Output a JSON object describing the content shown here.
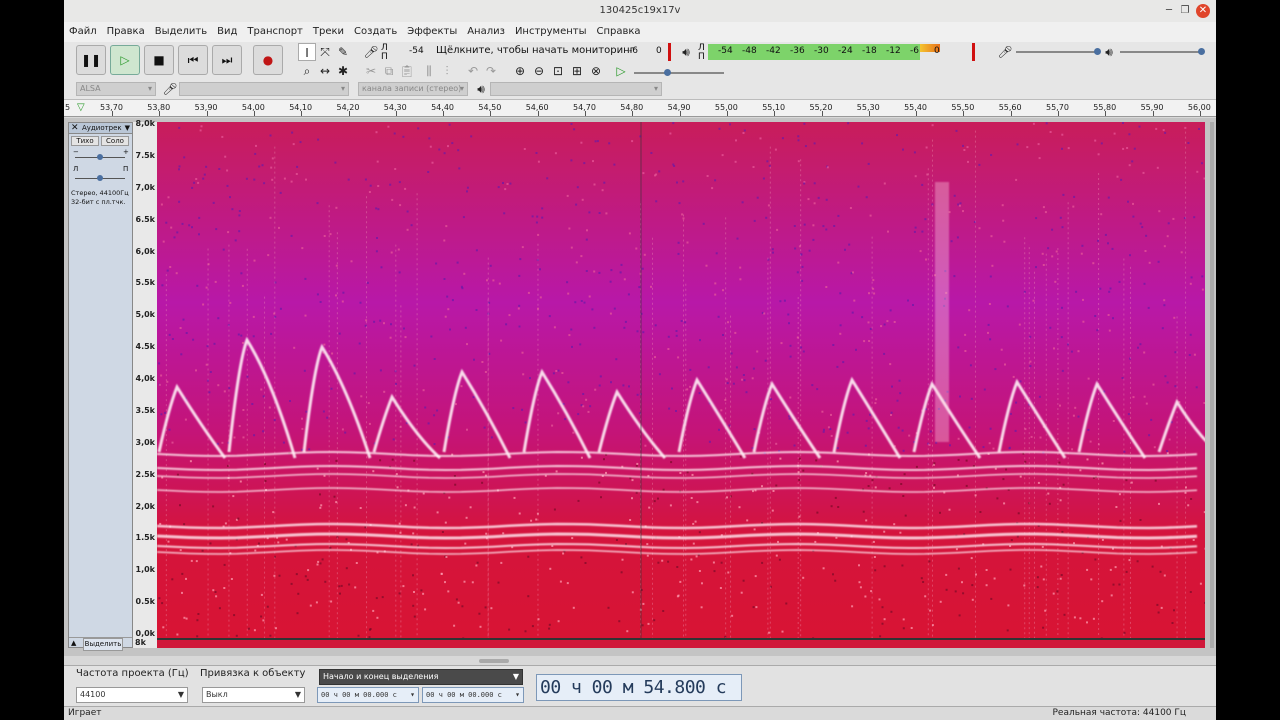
{
  "window": {
    "title": "130425c19x17v"
  },
  "menu": [
    "Файл",
    "Правка",
    "Выделить",
    "Вид",
    "Транспорт",
    "Треки",
    "Создать",
    "Эффекты",
    "Анализ",
    "Инструменты",
    "Справка"
  ],
  "transport": {
    "pause_icon": "pause-icon",
    "play_icon": "play-icon",
    "stop_icon": "stop-icon",
    "skip_start_icon": "skip-start-icon",
    "skip_end_icon": "skip-end-icon",
    "record_icon": "record-icon"
  },
  "recording_meter": {
    "channel_top": "Л",
    "channel_bottom": "П",
    "left_value": "-54",
    "monitor_hint": "Щёлкните, чтобы начать мониторинг",
    "mid_value": "-6",
    "right_value": "0"
  },
  "playback_meter": {
    "channel_top": "Л",
    "channel_bottom": "П",
    "scale": [
      "-54",
      "-48",
      "-42",
      "-36",
      "-30",
      "-24",
      "-18",
      "-12",
      "-6",
      "0"
    ]
  },
  "devices": {
    "host": "ALSA",
    "record_channels": "канала записи (стерео)"
  },
  "ruler": {
    "start_label": "5",
    "ticks": [
      "53,70",
      "53,80",
      "53,90",
      "54,00",
      "54,10",
      "54,20",
      "54,30",
      "54,40",
      "54,50",
      "54,60",
      "54,70",
      "54,80",
      "54,90",
      "55,00",
      "55,10",
      "55,20",
      "55,30",
      "55,40",
      "55,50",
      "55,60",
      "55,70",
      "55,80",
      "55,90",
      "56,00"
    ]
  },
  "track": {
    "name": "Аудиотрек",
    "mute": "Тихо",
    "solo": "Соло",
    "gain_minus": "−",
    "gain_plus": "+",
    "pan_left": "Л",
    "pan_right": "П",
    "info_line1": "Стерео, 44100Гц",
    "info_line2": "32-бит с пл.тчк.",
    "select": "Выделить",
    "collapse_icon": "collapse-arrow-icon",
    "bottom_scale_label": "8k"
  },
  "freq_scale": [
    "8,0k",
    "7.5k",
    "7,0k",
    "6.5k",
    "6,0k",
    "5.5k",
    "5,0k",
    "4.5k",
    "4,0k",
    "3.5k",
    "3,0k",
    "2.5k",
    "2,0k",
    "1.5k",
    "1,0k",
    "0.5k",
    "0,0k"
  ],
  "selection_toolbar": {
    "project_rate_label": "Частота проекта (Гц)",
    "project_rate": "44100",
    "snap_label": "Привязка к объекту",
    "snap_value": "Выкл",
    "selection_mode": "Начало и конец выделения",
    "sel_start": "00 ч 00 м 00.000 с",
    "sel_end": "00 ч 00 м 00.000 с",
    "position": "00 ч 00 м 54.800 с"
  },
  "status": {
    "left": "Играет",
    "right": "Реальная частота: 44100 Гц"
  },
  "colors": {
    "spectrogram_bg": "#d8143f",
    "spectrogram_purple": "#a414b8",
    "meter_green": "#7dd36a",
    "accent": "#2a7a2a"
  }
}
